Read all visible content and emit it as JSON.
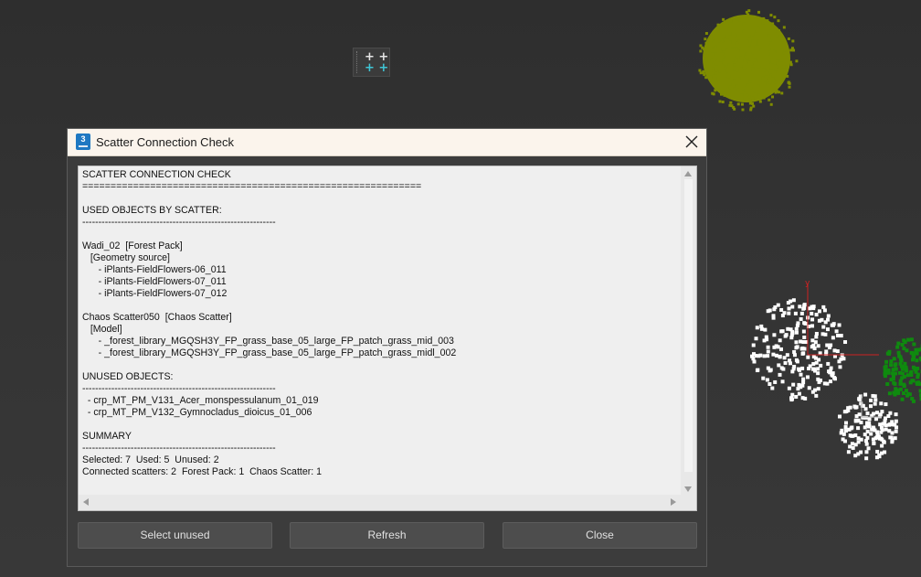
{
  "gizmo": {
    "row1": "+ +",
    "row2": "+ +"
  },
  "dialog": {
    "app_icon_text": "3",
    "title": "Scatter Connection Check",
    "report_lines": [
      "SCATTER CONNECTION CHECK",
      "============================================================",
      "",
      "USED OBJECTS BY SCATTER:",
      "------------------------------------------------------------",
      "",
      "Wadi_02  [Forest Pack]",
      "   [Geometry source]",
      "      - iPlants-FieldFlowers-06_011",
      "      - iPlants-FieldFlowers-07_011",
      "      - iPlants-FieldFlowers-07_012",
      "",
      "Chaos Scatter050  [Chaos Scatter]",
      "   [Model]",
      "      - _forest_library_MGQSH3Y_FP_grass_base_05_large_FP_patch_grass_mid_003",
      "      - _forest_library_MGQSH3Y_FP_grass_base_05_large_FP_patch_grass_midl_002",
      "",
      "UNUSED OBJECTS:",
      "------------------------------------------------------------",
      "  - crp_MT_PM_V131_Acer_monspessulanum_01_019",
      "  - crp_MT_PM_V132_Gymnocladus_dioicus_01_006",
      "",
      "SUMMARY",
      "------------------------------------------------------------",
      "Selected: 7  Used: 5  Unused: 2",
      "Connected scatters: 2  Forest Pack: 1  Chaos Scatter: 1"
    ],
    "buttons": {
      "select_unused": "Select unused",
      "refresh": "Refresh",
      "close": "Close"
    }
  },
  "colors": {
    "viewport_bg": "#333333",
    "tree_olive": "#7f8c00",
    "scatter_white": "#ffffff",
    "tree_green": "#0f8a0f",
    "axis_red": "#cc2222"
  }
}
